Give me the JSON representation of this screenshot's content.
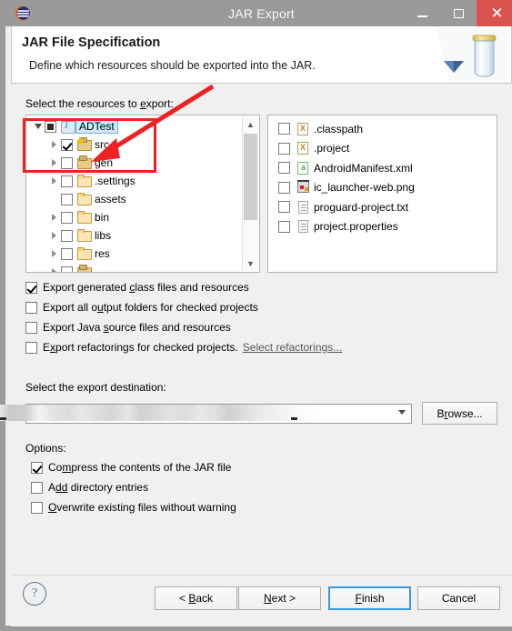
{
  "window": {
    "title": "JAR Export",
    "app_icon": "eclipse-icon",
    "buttons": {
      "minimize": "minimize-icon",
      "maximize": "maximize-icon",
      "close": "close-icon"
    },
    "close_color": "#d9534f",
    "frame_color": "#9a9a9a"
  },
  "banner": {
    "title": "JAR File Specification",
    "subtitle": "Define which resources should be exported into the JAR.",
    "art": "jar-jar-illustration"
  },
  "resources": {
    "label_before": "Select the resources to ",
    "label_accel": "e",
    "label_after": "xport:",
    "tree": [
      {
        "name": "ADTest",
        "indent": 0,
        "twisty": "open",
        "check": "grey",
        "icon": "java-project-icon",
        "selected": true
      },
      {
        "name": "src",
        "indent": 1,
        "twisty": "closed",
        "check": "checked",
        "icon": "source-folder-icon-warning",
        "selected": false
      },
      {
        "name": "gen",
        "indent": 1,
        "twisty": "closed",
        "check": "unchecked",
        "icon": "source-folder-icon",
        "selected": false
      },
      {
        "name": ".settings",
        "indent": 1,
        "twisty": "closed",
        "check": "unchecked",
        "icon": "folder-icon",
        "selected": false
      },
      {
        "name": "assets",
        "indent": 1,
        "twisty": "none",
        "check": "unchecked",
        "icon": "folder-icon",
        "selected": false
      },
      {
        "name": "bin",
        "indent": 1,
        "twisty": "closed",
        "check": "unchecked",
        "icon": "folder-icon",
        "selected": false
      },
      {
        "name": "libs",
        "indent": 1,
        "twisty": "closed",
        "check": "unchecked",
        "icon": "folder-icon",
        "selected": false
      },
      {
        "name": "res",
        "indent": 1,
        "twisty": "closed",
        "check": "unchecked",
        "icon": "folder-icon",
        "selected": false
      }
    ],
    "files": [
      {
        "name": ".classpath",
        "icon": "xml-x-file-icon",
        "check": "unchecked"
      },
      {
        "name": ".project",
        "icon": "xml-x-file-icon",
        "check": "unchecked"
      },
      {
        "name": "AndroidManifest.xml",
        "icon": "android-xml-icon",
        "check": "unchecked"
      },
      {
        "name": "ic_launcher-web.png",
        "icon": "image-file-icon",
        "check": "unchecked"
      },
      {
        "name": "proguard-project.txt",
        "icon": "text-file-icon",
        "check": "unchecked"
      },
      {
        "name": "project.properties",
        "icon": "text-file-icon",
        "check": "unchecked"
      }
    ]
  },
  "export_options": [
    {
      "pre": "Export generated ",
      "accel": "c",
      "post": "lass files and resources",
      "checked": true
    },
    {
      "pre": "Export all o",
      "accel": "u",
      "post": "tput folders for checked projects",
      "checked": false
    },
    {
      "pre": "Export Java ",
      "accel": "s",
      "post": "ource files and resources",
      "checked": false
    },
    {
      "pre": "E",
      "accel": "x",
      "post": "port refactorings for checked projects.",
      "checked": false,
      "link": "Select refactorings..."
    }
  ],
  "destination": {
    "label": "Select the export destination:",
    "value": "",
    "redacted": true,
    "dropdown_icon": "chevron-down-icon",
    "browse": {
      "pre": "B",
      "accel": "r",
      "post": "owse..."
    }
  },
  "options_section": {
    "label": "Options:",
    "items": [
      {
        "pre": "Co",
        "accel": "m",
        "post": "press the contents of the JAR file",
        "checked": true
      },
      {
        "pre": "A",
        "accel": "dd",
        "post": " directory entries",
        "checked": false
      },
      {
        "pre": "",
        "accel": "O",
        "post": "verwrite existing files without warning",
        "checked": false
      }
    ]
  },
  "footer": {
    "help_icon": "help-question-icon",
    "back": {
      "pre": "< ",
      "accel": "B",
      "post": "ack"
    },
    "next": {
      "pre": "",
      "accel": "N",
      "post": "ext >"
    },
    "finish": {
      "pre": "",
      "accel": "F",
      "post": "inish"
    },
    "cancel": {
      "pre": "",
      "accel": "",
      "post": "Cancel"
    },
    "default_button": "Finish",
    "focus_color": "#3399e0"
  },
  "annotations": {
    "highlight_color": "#ee2222",
    "rect_target": "ADTest and src tree rows",
    "arrow_target": "src checkbox"
  }
}
